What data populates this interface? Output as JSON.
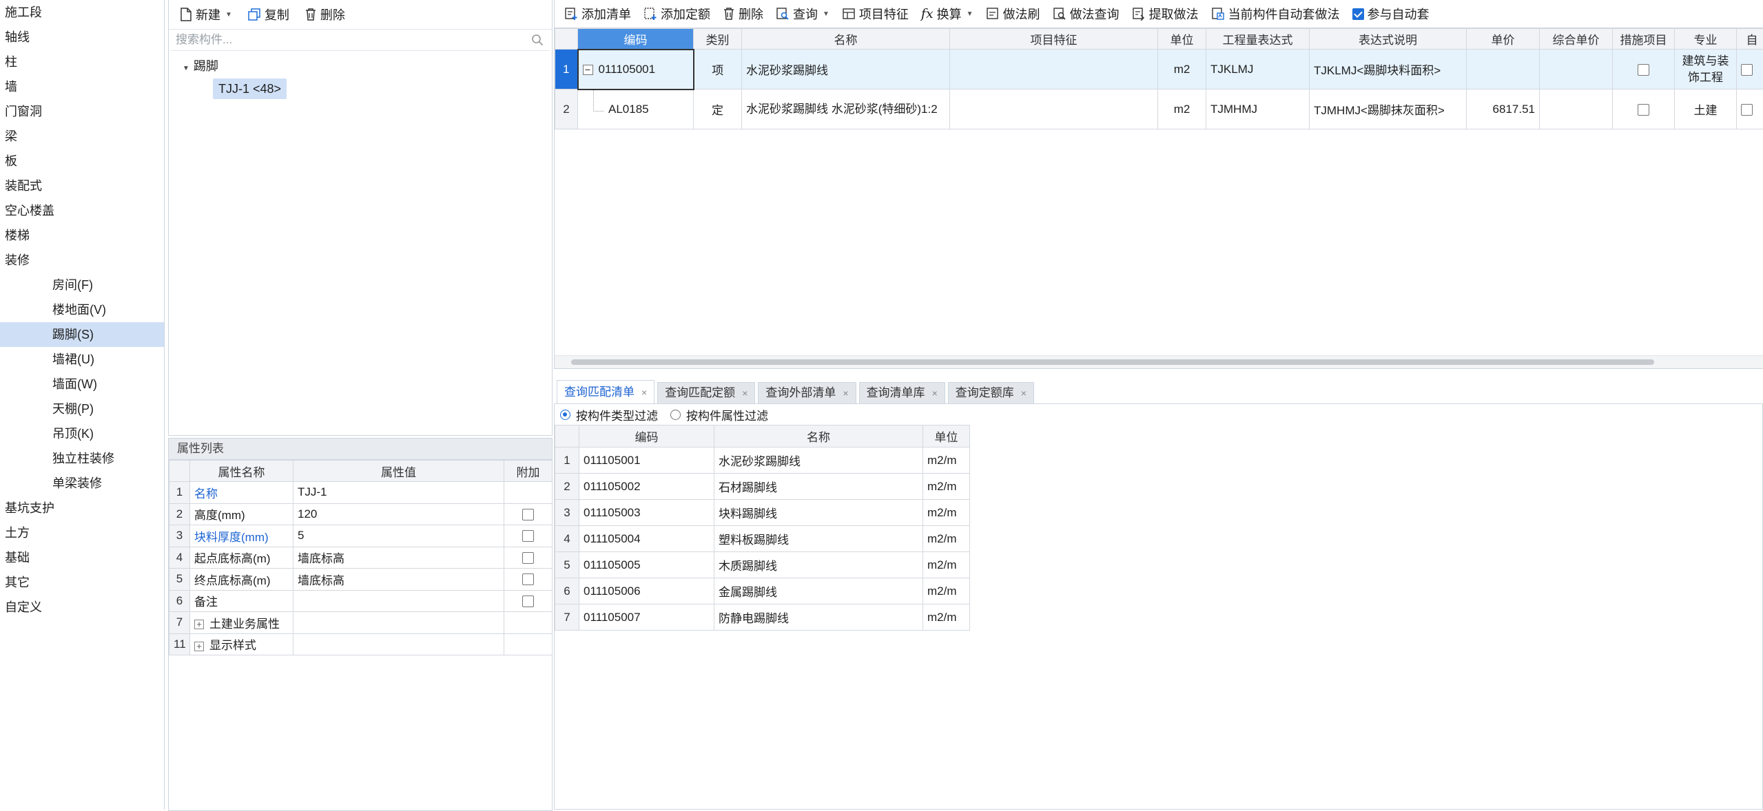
{
  "left_panel": {
    "categories_top": [
      "施工段",
      "轴线",
      "柱",
      "墙",
      "门窗洞",
      "梁",
      "板",
      "装配式",
      "空心楼盖",
      "楼梯",
      "装修"
    ],
    "decor_items": [
      {
        "label": "房间(F)",
        "icon": "room-icon"
      },
      {
        "label": "楼地面(V)",
        "icon": "floor-icon"
      },
      {
        "label": "踢脚(S)",
        "icon": "skirting-icon",
        "selected": true
      },
      {
        "label": "墙裙(U)",
        "icon": "dado-icon"
      },
      {
        "label": "墙面(W)",
        "icon": "wall-face-icon"
      },
      {
        "label": "天棚(P)",
        "icon": "ceiling-icon"
      },
      {
        "label": "吊顶(K)",
        "icon": "suspended-ceiling-icon"
      },
      {
        "label": "独立柱装修",
        "icon": "column-finish-icon"
      },
      {
        "label": "单梁装修",
        "icon": "beam-finish-icon"
      }
    ],
    "categories_bottom": [
      "基坑支护",
      "土方",
      "基础",
      "其它",
      "自定义"
    ]
  },
  "tree_panel": {
    "toolbar": {
      "new": "新建",
      "copy": "复制",
      "delete": "删除"
    },
    "search_placeholder": "搜索构件...",
    "root": "踢脚",
    "child": "TJJ-1 <48>"
  },
  "prop_panel": {
    "title": "属性列表",
    "headers": [
      "属性名称",
      "属性值",
      "附加"
    ],
    "rows": [
      {
        "n": "1",
        "name": "名称",
        "value": "TJJ-1",
        "blue": true,
        "check": false
      },
      {
        "n": "2",
        "name": "高度(mm)",
        "value": "120",
        "blue": false,
        "check": true
      },
      {
        "n": "3",
        "name": "块料厚度(mm)",
        "value": "5",
        "blue": true,
        "check": true
      },
      {
        "n": "4",
        "name": "起点底标高(m)",
        "value": "墙底标高",
        "blue": false,
        "check": true
      },
      {
        "n": "5",
        "name": "终点底标高(m)",
        "value": "墙底标高",
        "blue": false,
        "check": true
      },
      {
        "n": "6",
        "name": "备注",
        "value": "",
        "blue": false,
        "check": true
      },
      {
        "n": "7",
        "name": "土建业务属性",
        "value": "",
        "blue": false,
        "check": false,
        "expand": true
      },
      {
        "n": "11",
        "name": "显示样式",
        "value": "",
        "blue": false,
        "check": false,
        "expand": true
      }
    ]
  },
  "main_toolbar": {
    "add_list": "添加清单",
    "add_quota": "添加定额",
    "delete": "删除",
    "query": "查询",
    "item_feature": "项目特征",
    "convert": "换算",
    "method_brush": "做法刷",
    "method_query": "做法查询",
    "extract_method": "提取做法",
    "auto_apply": "当前构件自动套做法",
    "join_auto": "参与自动套"
  },
  "main_table": {
    "headers": [
      "编码",
      "类别",
      "名称",
      "项目特征",
      "单位",
      "工程量表达式",
      "表达式说明",
      "单价",
      "综合单价",
      "措施项目",
      "专业",
      "自"
    ],
    "rows": [
      {
        "n": "1",
        "code": "011105001",
        "type": "项",
        "name": "水泥砂浆踢脚线",
        "feature": "",
        "unit": "m2",
        "expr": "TJKLMJ",
        "expr_desc": "TJKLMJ<踢脚块料面积>",
        "price": "",
        "total_price": "",
        "major": "建筑与装饰工程"
      },
      {
        "n": "2",
        "code": "AL0185",
        "type": "定",
        "name": "水泥砂浆踢脚线 水泥砂浆(特细砂)1:2",
        "feature": "",
        "unit": "m2",
        "expr": "TJMHMJ",
        "expr_desc": "TJMHMJ<踢脚抹灰面积>",
        "price": "6817.51",
        "total_price": "",
        "major": "土建"
      }
    ]
  },
  "bottom_tabs": [
    "查询匹配清单",
    "查询匹配定额",
    "查询外部清单",
    "查询清单库",
    "查询定额库"
  ],
  "filter": {
    "by_type": "按构件类型过滤",
    "by_attr": "按构件属性过滤"
  },
  "match_table": {
    "headers": [
      "编码",
      "名称",
      "单位"
    ],
    "rows": [
      {
        "n": "1",
        "code": "011105001",
        "name": "水泥砂浆踢脚线",
        "unit": "m2/m"
      },
      {
        "n": "2",
        "code": "011105002",
        "name": "石材踢脚线",
        "unit": "m2/m"
      },
      {
        "n": "3",
        "code": "011105003",
        "name": "块料踢脚线",
        "unit": "m2/m"
      },
      {
        "n": "4",
        "code": "011105004",
        "name": "塑料板踢脚线",
        "unit": "m2/m"
      },
      {
        "n": "5",
        "code": "011105005",
        "name": "木质踢脚线",
        "unit": "m2/m"
      },
      {
        "n": "6",
        "code": "011105006",
        "name": "金属踢脚线",
        "unit": "m2/m"
      },
      {
        "n": "7",
        "code": "011105007",
        "name": "防静电踢脚线",
        "unit": "m2/m"
      }
    ]
  },
  "colors": {
    "accent": "#1e6fd9",
    "selected_bg": "#cfe0f6",
    "row_highlight": "#e6f3fc"
  }
}
